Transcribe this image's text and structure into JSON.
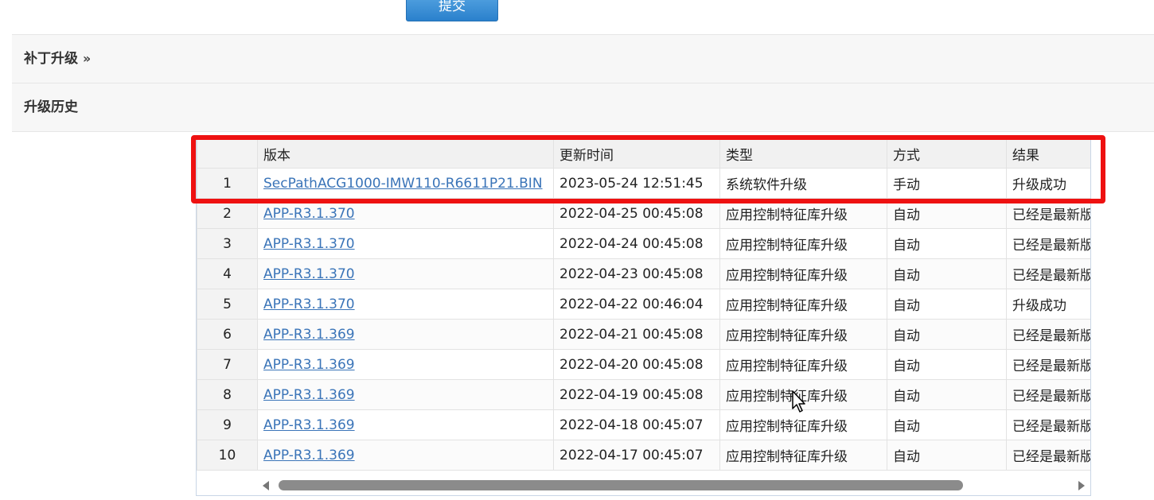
{
  "submit_label": "提交",
  "sections": {
    "patch_label": "补丁升级",
    "patch_chevron": "››",
    "history_label": "升级历史"
  },
  "table": {
    "headers": [
      "",
      "版本",
      "更新时间",
      "类型",
      "方式",
      "结果"
    ],
    "rows": [
      [
        "1",
        "SecPathACG1000-IMW110-R6611P21.BIN",
        "2023-05-24 12:51:45",
        "系统软件升级",
        "手动",
        "升级成功"
      ],
      [
        "2",
        "APP-R3.1.370",
        "2022-04-25 00:45:08",
        "应用控制特征库升级",
        "自动",
        "已经是最新版"
      ],
      [
        "3",
        "APP-R3.1.370",
        "2022-04-24 00:45:08",
        "应用控制特征库升级",
        "自动",
        "已经是最新版"
      ],
      [
        "4",
        "APP-R3.1.370",
        "2022-04-23 00:45:08",
        "应用控制特征库升级",
        "自动",
        "已经是最新版"
      ],
      [
        "5",
        "APP-R3.1.370",
        "2022-04-22 00:46:04",
        "应用控制特征库升级",
        "自动",
        "升级成功"
      ],
      [
        "6",
        "APP-R3.1.369",
        "2022-04-21 00:45:08",
        "应用控制特征库升级",
        "自动",
        "已经是最新版"
      ],
      [
        "7",
        "APP-R3.1.369",
        "2022-04-20 00:45:08",
        "应用控制特征库升级",
        "自动",
        "已经是最新版"
      ],
      [
        "8",
        "APP-R3.1.369",
        "2022-04-19 00:45:08",
        "应用控制特征库升级",
        "自动",
        "已经是最新版"
      ],
      [
        "9",
        "APP-R3.1.369",
        "2022-04-18 00:45:07",
        "应用控制特征库升级",
        "自动",
        "已经是最新版"
      ],
      [
        "10",
        "APP-R3.1.369",
        "2022-04-17 00:45:07",
        "应用控制特征库升级",
        "自动",
        "已经是最新版"
      ]
    ]
  },
  "colors": {
    "highlight": "#ee1111",
    "link": "#3a74b8",
    "button": "#2a80cc"
  },
  "icons": {
    "scroll_left": "scroll-left-arrow-icon",
    "scroll_right": "scroll-right-arrow-icon",
    "cursor": "mouse-pointer-icon"
  }
}
